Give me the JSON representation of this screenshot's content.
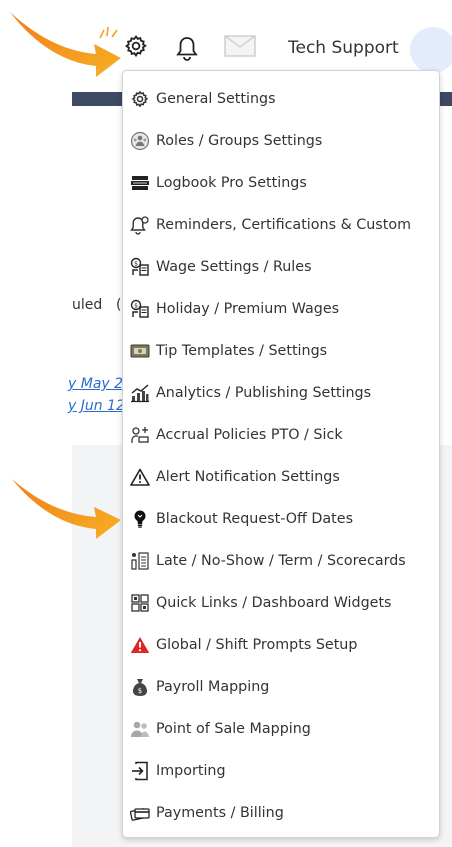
{
  "header": {
    "user_name": "Tech Support",
    "icons": [
      "gear-icon",
      "bell-icon",
      "mail-icon"
    ]
  },
  "background": {
    "partial_status": "uled",
    "partial_dates": [
      "y May 2",
      "y Jun 12"
    ]
  },
  "settings_menu": {
    "items": [
      {
        "label": "General Settings",
        "icon": "gear-icon"
      },
      {
        "label": "Roles / Groups Settings",
        "icon": "roles-icon"
      },
      {
        "label": "Logbook Pro Settings",
        "icon": "logbook-icon"
      },
      {
        "label": "Reminders, Certifications & Custom",
        "icon": "reminder-bell-icon"
      },
      {
        "label": "Wage Settings / Rules",
        "icon": "wage-icon"
      },
      {
        "label": "Holiday / Premium Wages",
        "icon": "holiday-wage-icon"
      },
      {
        "label": "Tip Templates / Settings",
        "icon": "tip-icon"
      },
      {
        "label": "Analytics / Publishing Settings",
        "icon": "analytics-icon"
      },
      {
        "label": "Accrual Policies PTO / Sick",
        "icon": "accrual-icon"
      },
      {
        "label": "Alert Notification Settings",
        "icon": "alert-triangle-icon"
      },
      {
        "label": "Blackout Request-Off Dates",
        "icon": "lightbulb-icon"
      },
      {
        "label": "Late / No-Show / Term / Scorecards",
        "icon": "scorecard-icon"
      },
      {
        "label": "Quick Links / Dashboard Widgets",
        "icon": "widgets-icon"
      },
      {
        "label": "Global / Shift Prompts Setup",
        "icon": "warning-red-icon"
      },
      {
        "label": "Payroll Mapping",
        "icon": "money-bag-icon"
      },
      {
        "label": "Point of Sale Mapping",
        "icon": "people-icon"
      },
      {
        "label": "Importing",
        "icon": "import-icon"
      },
      {
        "label": "Payments / Billing",
        "icon": "payment-cards-icon"
      }
    ]
  },
  "colors": {
    "arrow": "#f39a1a",
    "header_band": "#3e4a63",
    "link": "#2c6bd1",
    "warning_red": "#e02424"
  }
}
